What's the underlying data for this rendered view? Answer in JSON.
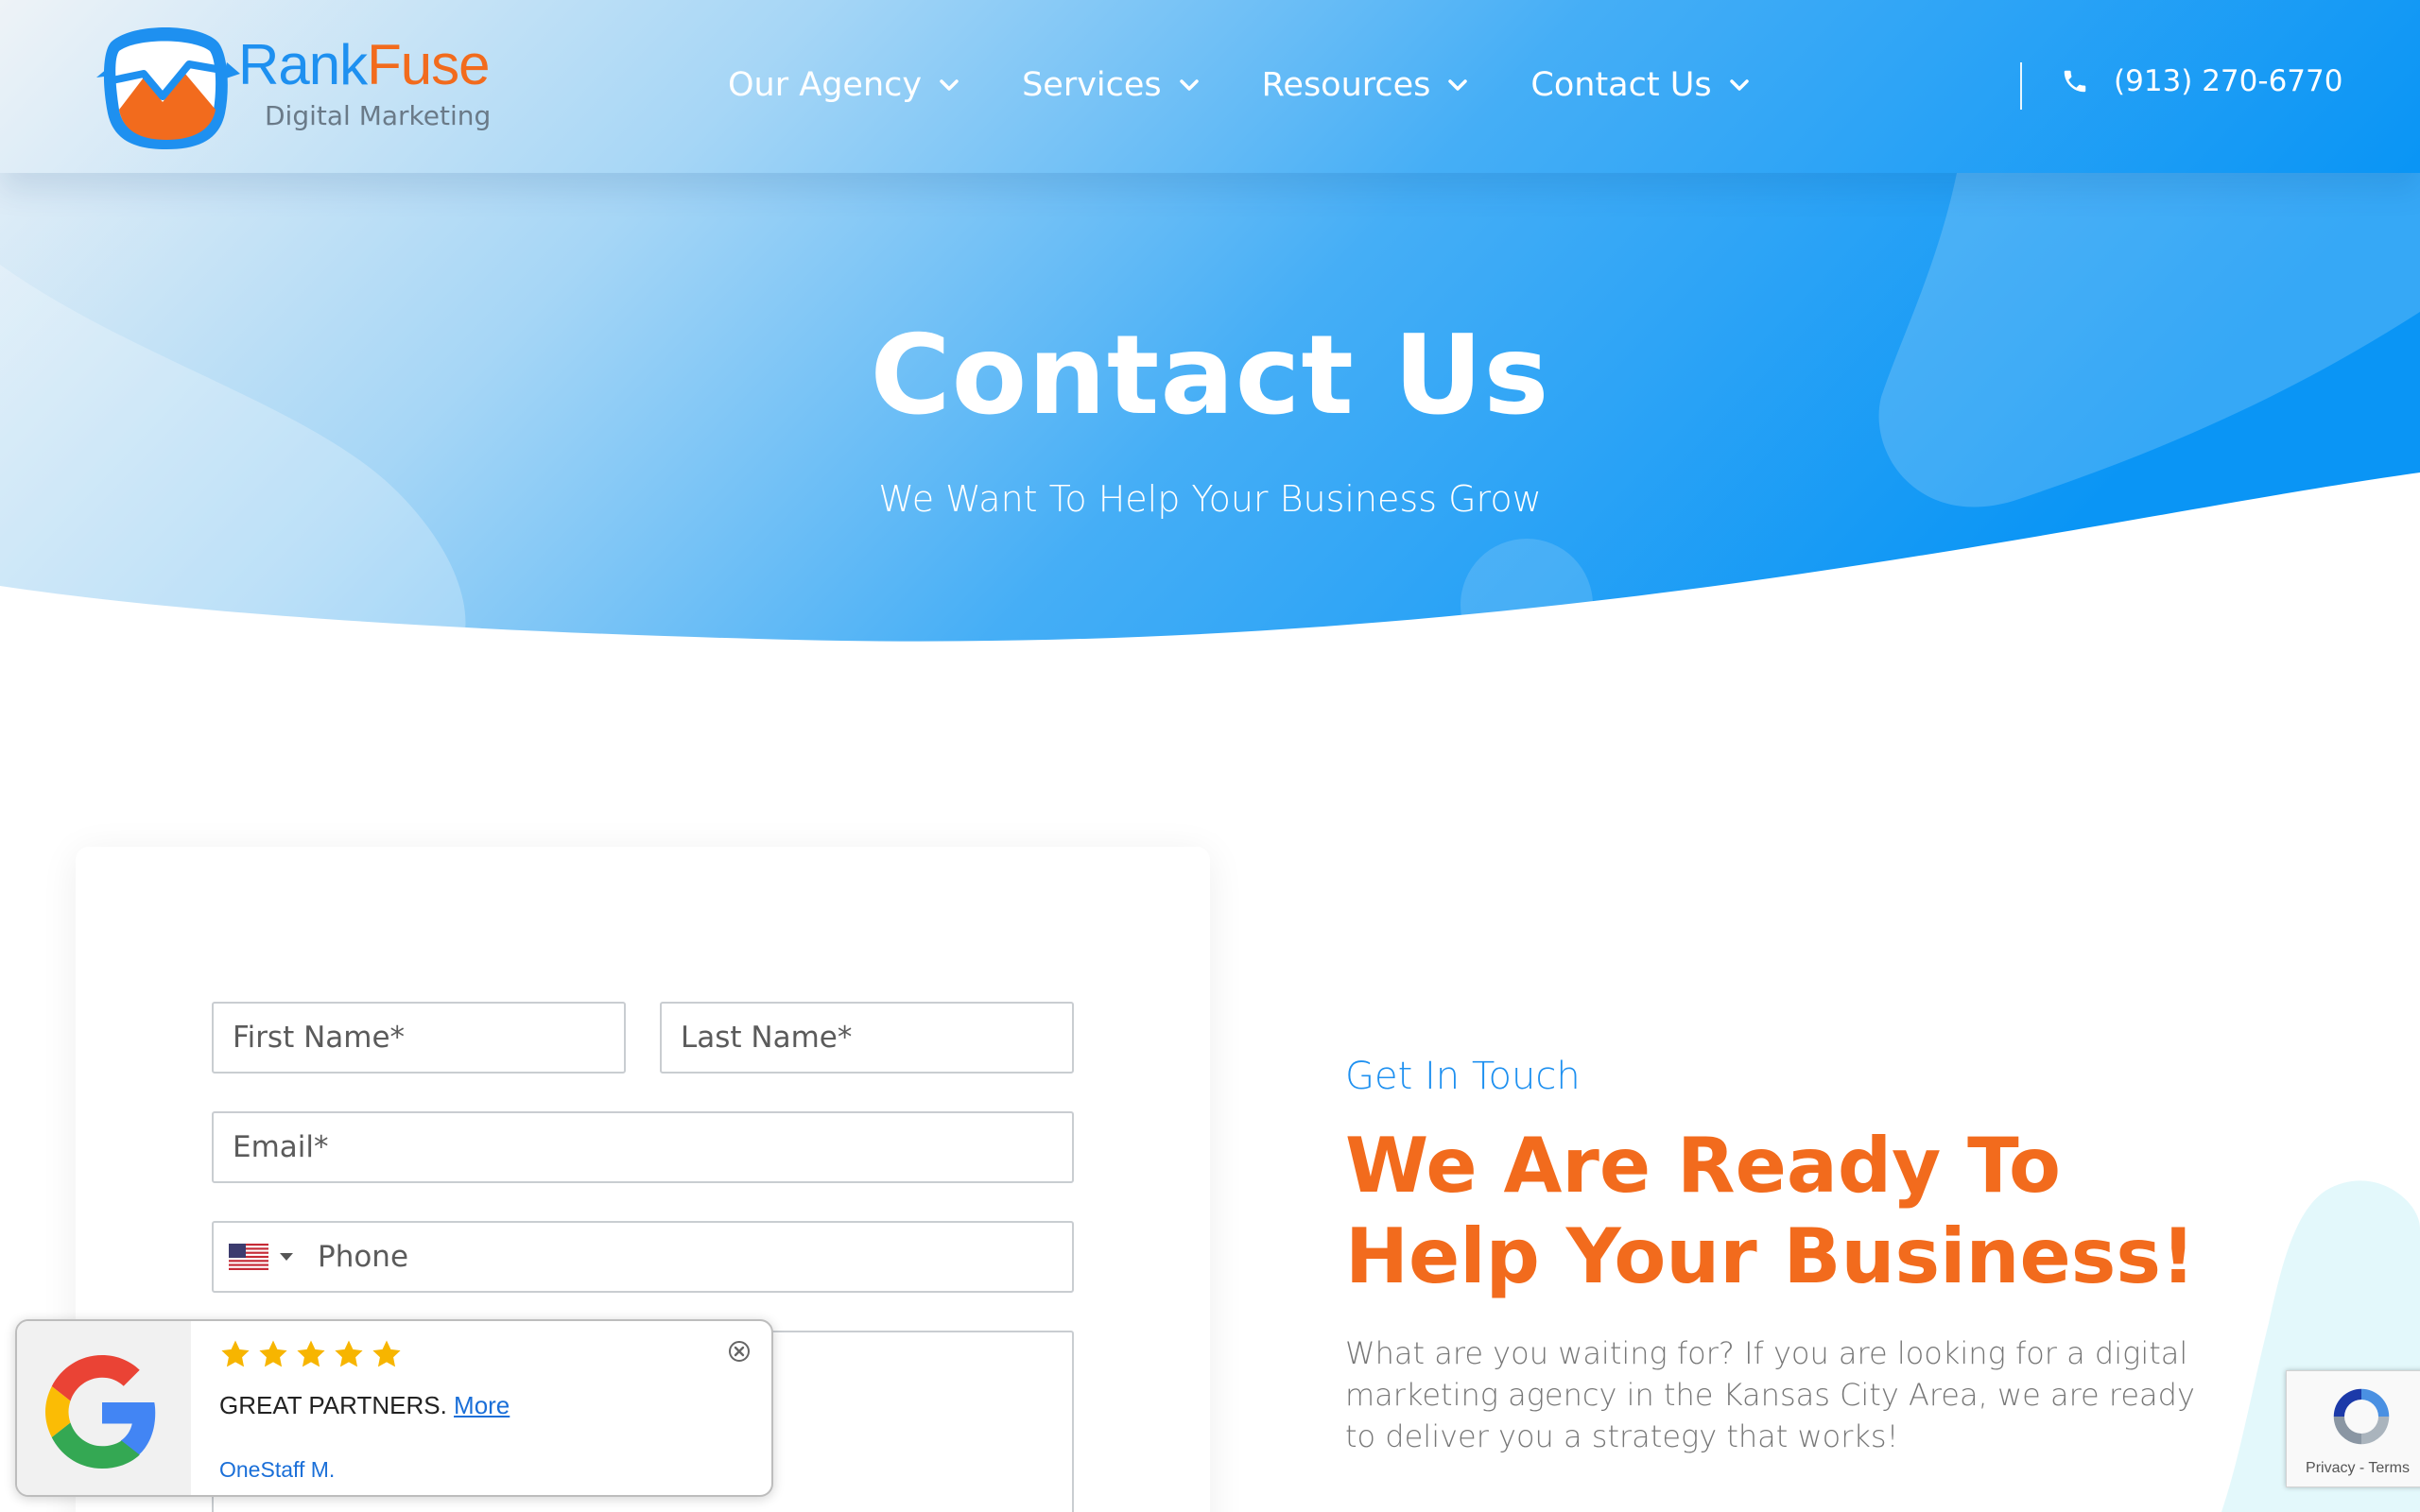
{
  "brand": {
    "name_part1": "Rank",
    "name_part2": "Fuse",
    "tagline": "Digital Marketing",
    "colors": {
      "blue": "#1e90f0",
      "orange": "#f26b1d"
    }
  },
  "nav": {
    "items": [
      {
        "label": "Our Agency",
        "icon": "chevron-down-icon"
      },
      {
        "label": "Services",
        "icon": "chevron-down-icon"
      },
      {
        "label": "Resources",
        "icon": "chevron-down-icon"
      },
      {
        "label": "Contact Us",
        "icon": "chevron-down-icon"
      }
    ],
    "phone": "(913) 270-6770",
    "phone_icon": "phone-icon"
  },
  "hero": {
    "title": "Contact Us",
    "subtitle": "We Want To Help Your Business Grow"
  },
  "form": {
    "first_name_placeholder": "First Name*",
    "last_name_placeholder": "Last Name*",
    "email_placeholder": "Email*",
    "phone_placeholder": "Phone",
    "country_flag": "us-flag-icon"
  },
  "contact_info": {
    "eyebrow": "Get In Touch",
    "headline": "We Are Ready To Help Your Business!",
    "paragraph": "What are you waiting for? If you are looking for a digital marketing agency in the Kansas City Area, we are ready to deliver you a strategy that works!"
  },
  "review_widget": {
    "rating": 5,
    "max_rating": 5,
    "text": "GREAT PARTNERS.",
    "more_link": "More",
    "reviewer": "OneStaff M.",
    "source_icon": "google-g-icon"
  },
  "recaptcha": {
    "privacy": "Privacy",
    "separator": " - ",
    "terms": "Terms"
  }
}
